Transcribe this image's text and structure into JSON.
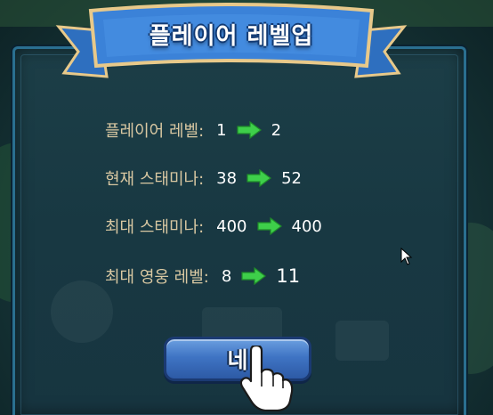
{
  "dialog": {
    "title": "플레이어 레벨업",
    "stats": [
      {
        "label": "플레이어 레벨:",
        "old": "1",
        "new": "2"
      },
      {
        "label": "현재 스태미나:",
        "old": "38",
        "new": "52"
      },
      {
        "label": "최대 스태미나:",
        "old": "400",
        "new": "400"
      },
      {
        "label": "최대 영웅 레벨:",
        "old": "8",
        "new": "11"
      }
    ],
    "confirm_label": "네"
  },
  "icons": {
    "arrow": "green-right-arrow-icon",
    "hand": "pointing-hand-icon",
    "cursor": "mouse-cursor-icon"
  },
  "colors": {
    "label": "#d9c8a2",
    "value": "#ffffff",
    "arrow": "#3ecf4a",
    "button": "#3f74c4",
    "ribbon": "#3b82d8"
  }
}
